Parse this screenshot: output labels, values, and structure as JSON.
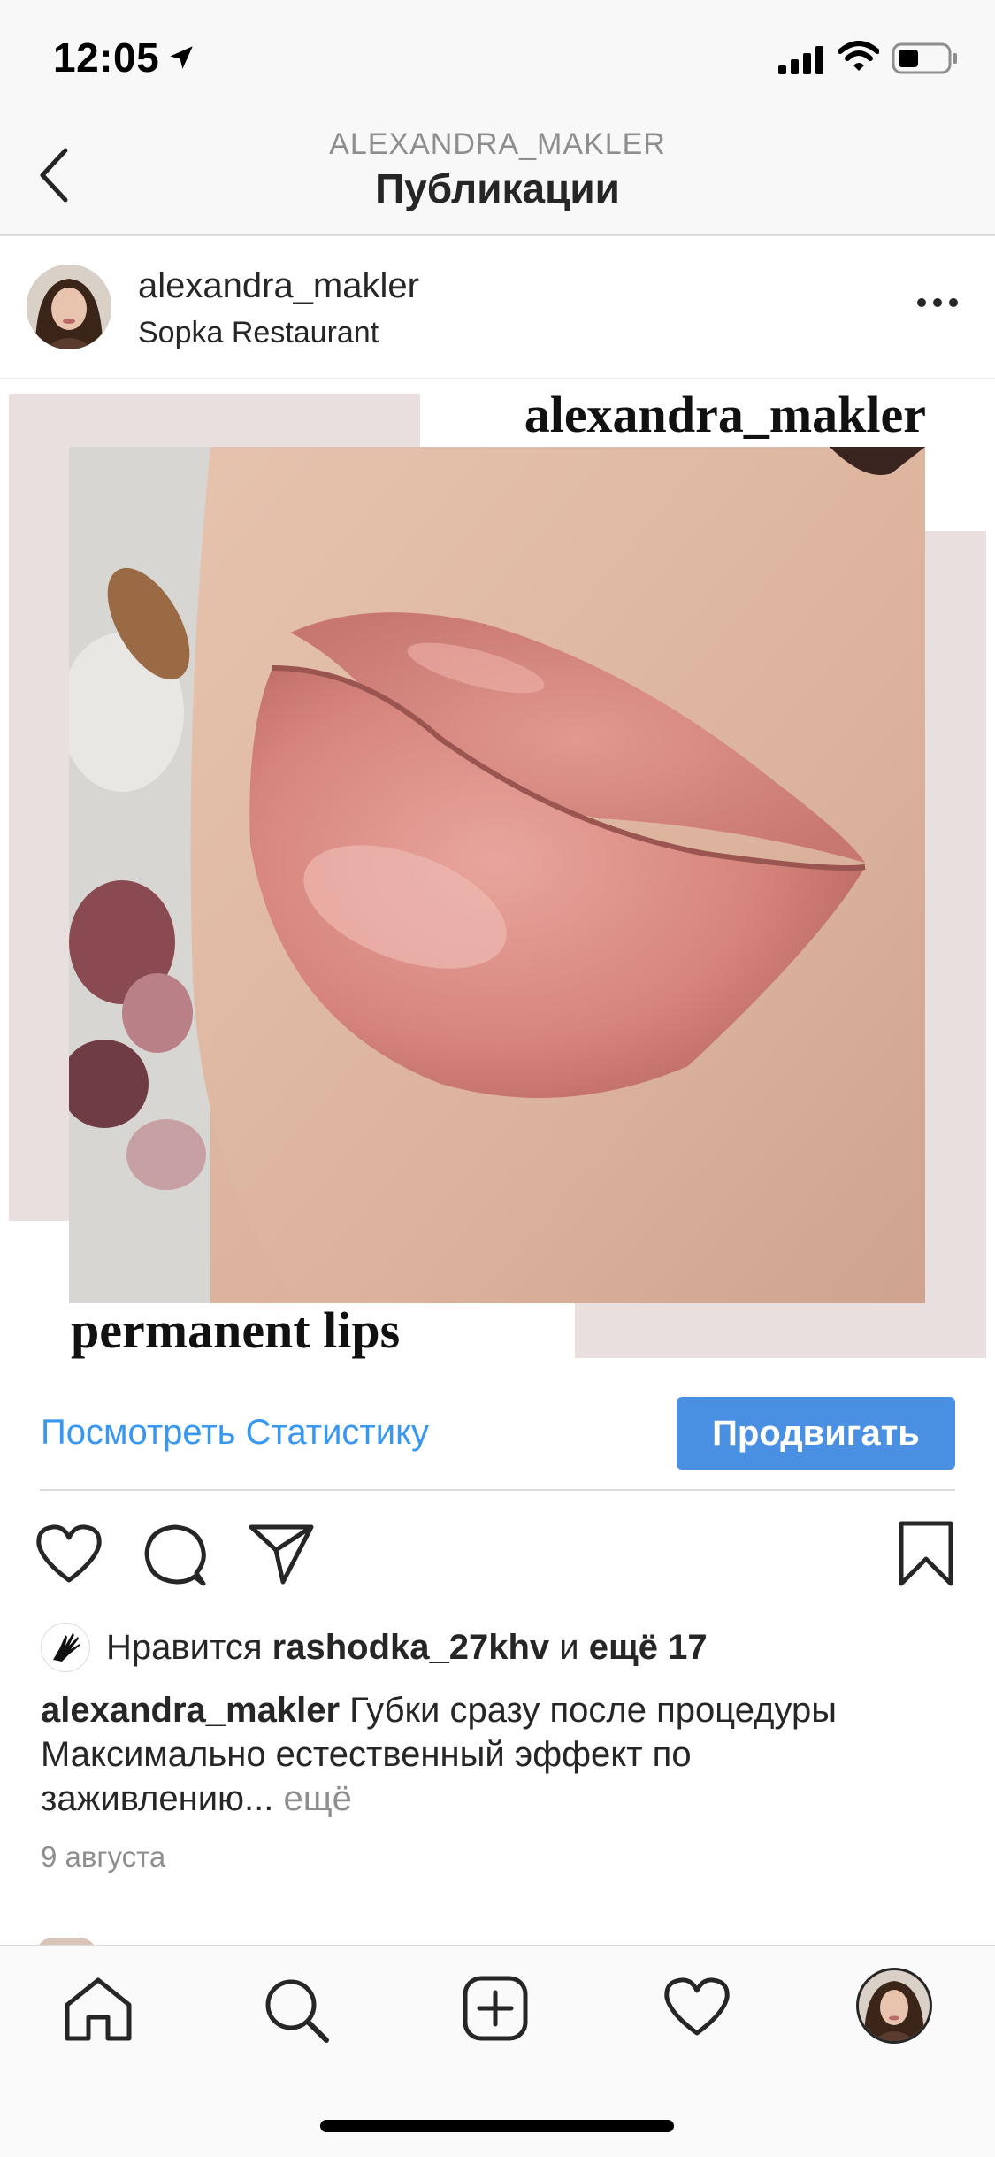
{
  "status_bar": {
    "time": "12:05",
    "icons": [
      "location-arrow-icon",
      "cellular-signal-icon",
      "wifi-icon",
      "battery-icon"
    ]
  },
  "header": {
    "subtitle": "ALEXANDRA_MAKLER",
    "title": "Публикации",
    "back_icon": "chevron-left-icon"
  },
  "post": {
    "username": "alexandra_makler",
    "location": "Sopka Restaurant",
    "more_icon": "ellipsis-icon",
    "image": {
      "brand_text": "alexandra_makler",
      "caption_text": "permanent lips"
    },
    "promote": {
      "stats_link": "Посмотреть Статистику",
      "promote_button": "Продвигать"
    },
    "likes": {
      "prefix": "Нравится",
      "liker": "rashodka_27khv",
      "conjunction": "и",
      "others": "ещё 17"
    },
    "caption": {
      "author": "alexandra_makler",
      "line1": "Губки сразу после процедуры",
      "line2": "Максимально естественный эффект по",
      "line3": "заживлению...",
      "more": "ещё"
    },
    "date": "9 августа"
  },
  "tab_bar": {
    "items": [
      "home-icon",
      "search-icon",
      "add-post-icon",
      "activity-heart-icon",
      "profile-avatar"
    ]
  },
  "colors": {
    "link_blue": "#3897f0",
    "promote_button": "#4a90e2",
    "bar_background": "#f8f8f8",
    "muted_text": "#8e8e8e",
    "photo_frame": "#e9dfdf"
  }
}
